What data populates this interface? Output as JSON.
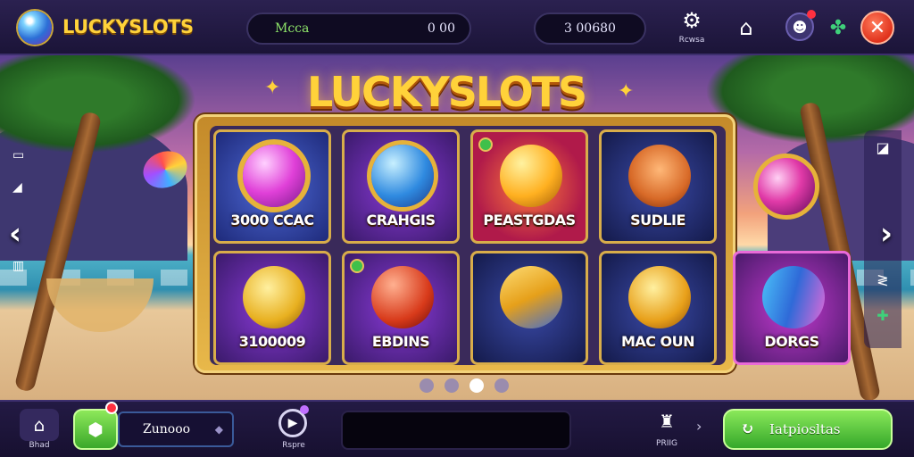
{
  "header": {
    "app_title": "LUCKYSLOTS",
    "balance_label": "Mcca",
    "balance_value": "0 00",
    "coins_value": "3 00680",
    "settings_label": "Rcwsa"
  },
  "banner": {
    "title": "LUCKYSLOTS"
  },
  "games": [
    {
      "name": "3000 CCAC",
      "style": "t-blue",
      "art": "a-gem",
      "icon": "gem-icon"
    },
    {
      "name": "CRAHGIS",
      "style": "t-purple",
      "art": "a-blue",
      "icon": "blue-candy-icon"
    },
    {
      "name": "PEASTGDAS",
      "style": "t-red",
      "art": "a-gold",
      "icon": "gold-link-icon"
    },
    {
      "name": "SUDLIE",
      "style": "t-navy",
      "art": "a-cat",
      "icon": "cat-icon"
    },
    {
      "name": "3100009",
      "style": "t-purple",
      "art": "a-goldanimal",
      "icon": "gold-animal-icon"
    },
    {
      "name": "EBDINS",
      "style": "t-purple",
      "art": "a-red",
      "icon": "red-ball-icon"
    },
    {
      "name": "",
      "style": "t-navy",
      "art": "a-tri",
      "icon": "triangle-gem-icon"
    },
    {
      "name": "MAC OUN",
      "style": "t-navy",
      "art": "a-croissant",
      "icon": "croissant-icon"
    },
    {
      "name": "DORGS",
      "style": "t-magenta",
      "art": "a-bone",
      "icon": "bone-icon"
    }
  ],
  "pagination": {
    "count": 4,
    "active": 2
  },
  "footer": {
    "home_label": "Bhad",
    "coin_input_value": "Zunooo",
    "replay_label": "Rspre",
    "search_value": "",
    "paint_label": "PRIIG",
    "cta_label": "Iatpiosltas"
  },
  "colors": {
    "accent_gold": "#ffd23a",
    "cta_green": "#3aa82a",
    "close_red": "#e0321c"
  }
}
